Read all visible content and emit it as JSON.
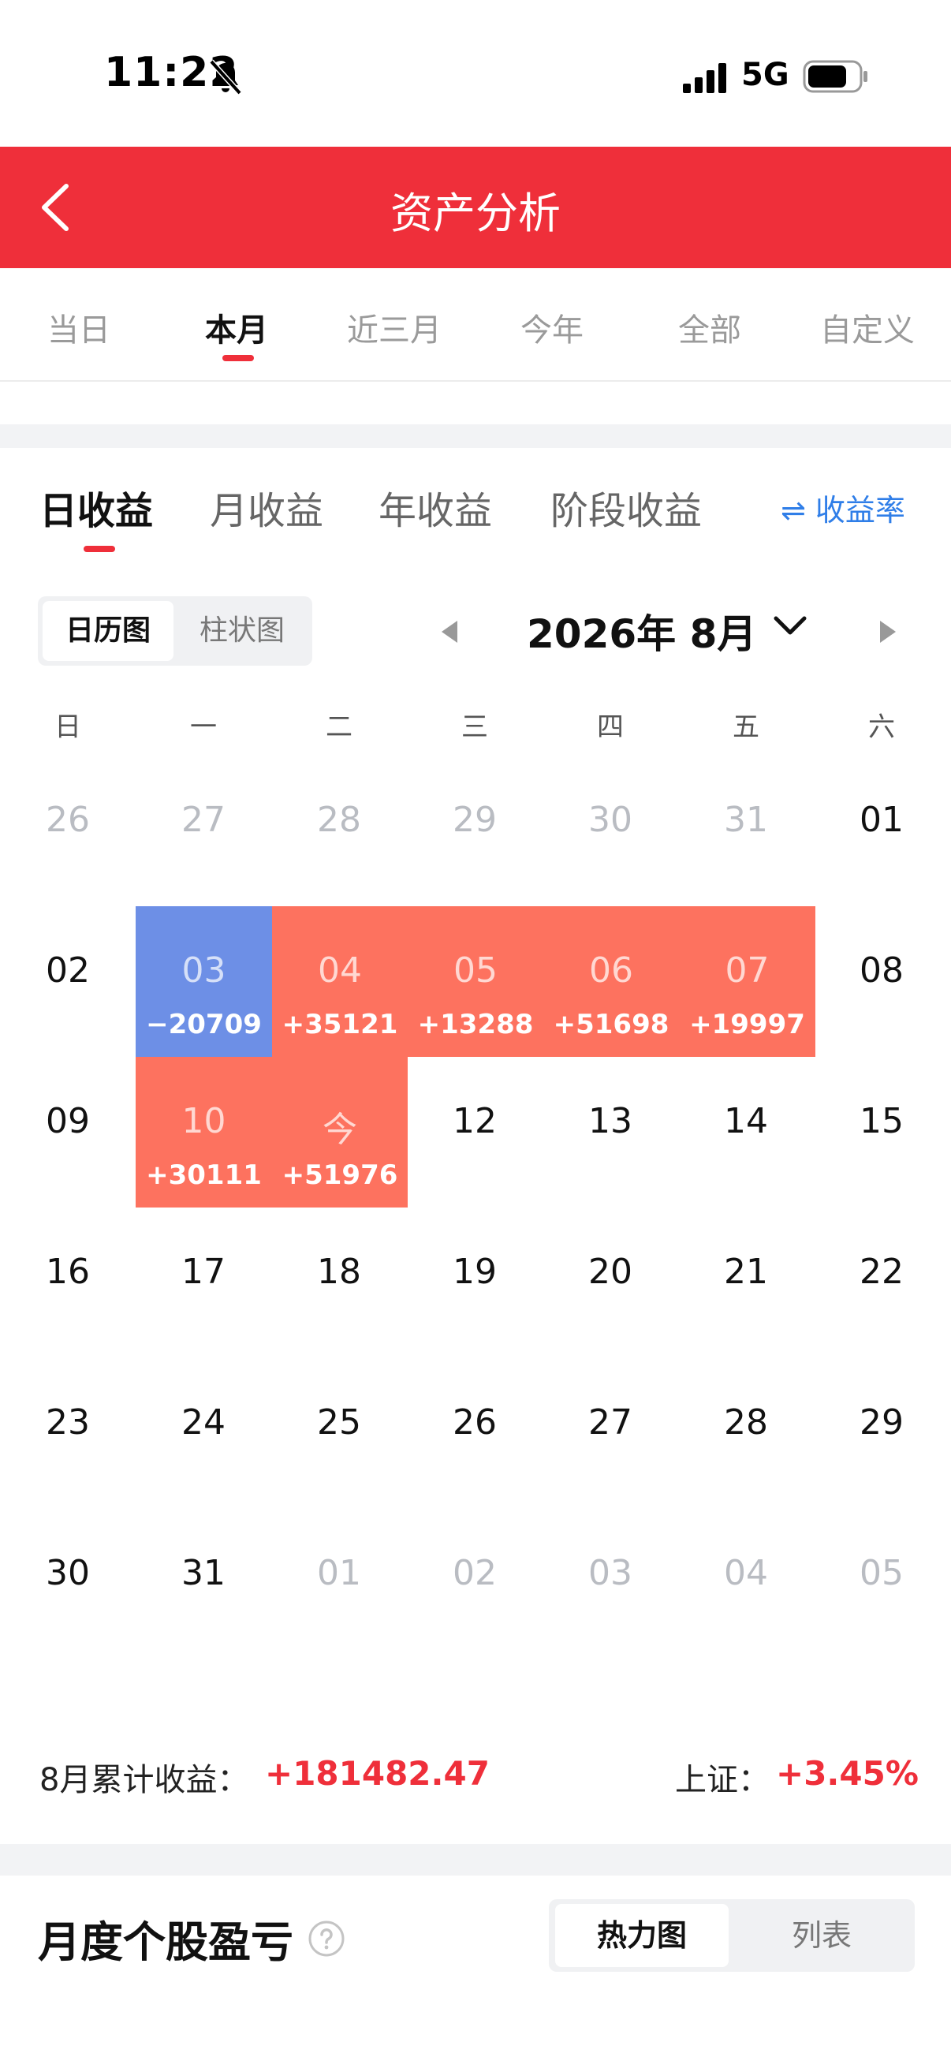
{
  "status_bar": {
    "time": "11:22",
    "network": "5G"
  },
  "header": {
    "title": "资产分析"
  },
  "period_tabs": [
    {
      "label": "当日",
      "active": false
    },
    {
      "label": "本月",
      "active": true
    },
    {
      "label": "近三月",
      "active": false
    },
    {
      "label": "今年",
      "active": false
    },
    {
      "label": "全部",
      "active": false
    },
    {
      "label": "自定义",
      "active": false
    }
  ],
  "income_tabs": [
    {
      "label": "日收益",
      "active": true
    },
    {
      "label": "月收益",
      "active": false
    },
    {
      "label": "年收益",
      "active": false
    },
    {
      "label": "阶段收益",
      "active": false
    }
  ],
  "rate_toggle": {
    "label": "⇌ 收益率"
  },
  "view_switch": {
    "calendar_label": "日历图",
    "bar_label": "柱状图"
  },
  "month_nav": {
    "label": "2026年 8月"
  },
  "weekdays": [
    "日",
    "一",
    "二",
    "三",
    "四",
    "五",
    "六"
  ],
  "calendar": {
    "weeks": [
      [
        {
          "day": "26",
          "other": true
        },
        {
          "day": "27",
          "other": true
        },
        {
          "day": "28",
          "other": true
        },
        {
          "day": "29",
          "other": true
        },
        {
          "day": "30",
          "other": true
        },
        {
          "day": "31",
          "other": true
        },
        {
          "day": "01"
        }
      ],
      [
        {
          "day": "02"
        },
        {
          "day": "03",
          "value": "−20709",
          "kind": "neg"
        },
        {
          "day": "04",
          "value": "+35121",
          "kind": "pos"
        },
        {
          "day": "05",
          "value": "+13288",
          "kind": "pos"
        },
        {
          "day": "06",
          "value": "+51698",
          "kind": "pos"
        },
        {
          "day": "07",
          "value": "+19997",
          "kind": "pos"
        },
        {
          "day": "08"
        }
      ],
      [
        {
          "day": "09"
        },
        {
          "day": "10",
          "value": "+30111",
          "kind": "pos"
        },
        {
          "day": "今",
          "value": "+51976",
          "kind": "pos"
        },
        {
          "day": "12"
        },
        {
          "day": "13"
        },
        {
          "day": "14"
        },
        {
          "day": "15"
        }
      ],
      [
        {
          "day": "16"
        },
        {
          "day": "17"
        },
        {
          "day": "18"
        },
        {
          "day": "19"
        },
        {
          "day": "20"
        },
        {
          "day": "21"
        },
        {
          "day": "22"
        }
      ],
      [
        {
          "day": "23"
        },
        {
          "day": "24"
        },
        {
          "day": "25"
        },
        {
          "day": "26"
        },
        {
          "day": "27"
        },
        {
          "day": "28"
        },
        {
          "day": "29"
        }
      ],
      [
        {
          "day": "30"
        },
        {
          "day": "31"
        },
        {
          "day": "01",
          "other": true
        },
        {
          "day": "02",
          "other": true
        },
        {
          "day": "03",
          "other": true
        },
        {
          "day": "04",
          "other": true
        },
        {
          "day": "05",
          "other": true
        }
      ]
    ]
  },
  "summary": {
    "month_label": "8月累计收益：",
    "month_value": "+181482.47",
    "index_label": "上证：",
    "index_value": "+3.45%"
  },
  "stock_section": {
    "title": "月度个股盈亏",
    "heatmap_label": "热力图",
    "list_label": "列表"
  },
  "colors": {
    "brand_red": "#ef2f3a",
    "gain_cell": "#fd725f",
    "loss_cell": "#6d8fe6",
    "link_blue": "#2f7ee8"
  },
  "icons": {
    "back": "chevron-left-icon",
    "mute": "bell-off-icon",
    "help": "question-circle-icon",
    "dropdown": "chevron-down-icon"
  }
}
